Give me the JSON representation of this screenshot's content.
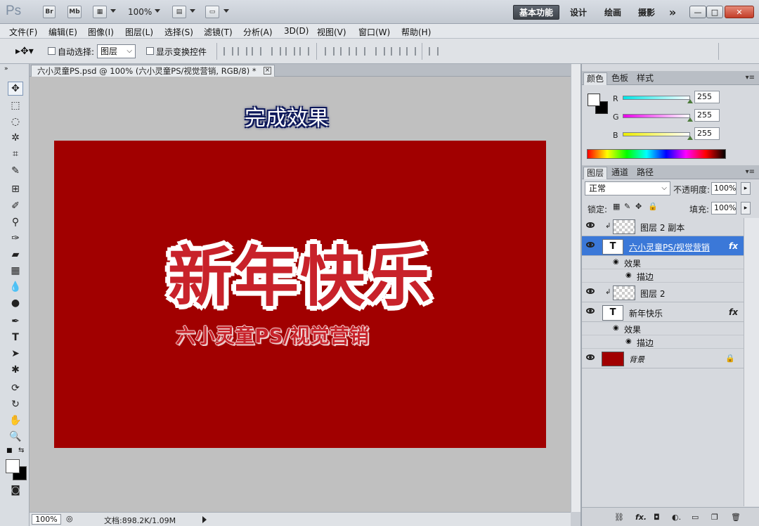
{
  "titlebar": {
    "app_logo": "Ps",
    "btn_br": "Br",
    "btn_mb": "Mb",
    "zoom": "100%",
    "workspaces": [
      "基本功能",
      "设计",
      "绘画",
      "摄影"
    ],
    "more": "»"
  },
  "menu": [
    "文件(F)",
    "编辑(E)",
    "图像(I)",
    "图层(L)",
    "选择(S)",
    "滤镜(T)",
    "分析(A)",
    "3D(D)",
    "视图(V)",
    "窗口(W)",
    "帮助(H)"
  ],
  "options": {
    "auto_select_label": "自动选择:",
    "auto_select_value": "图层",
    "show_transform_label": "显示变换控件"
  },
  "document": {
    "tab_title": "六小灵童PS.psd @ 100% (六小灵童PS/视觉营销, RGB/8) *",
    "close": "×"
  },
  "canvas": {
    "headline": "完成效果",
    "big_title": "新年快乐",
    "sub_title": "六小灵童PS/视觉营销",
    "background_color": "#a10000"
  },
  "status": {
    "zoom": "100%",
    "doc_info": "文档:898.2K/1.09M"
  },
  "color_panel": {
    "tabs": [
      "颜色",
      "色板",
      "样式"
    ],
    "channels": [
      {
        "label": "R",
        "value": "255",
        "color": "#00e5e5"
      },
      {
        "label": "G",
        "value": "255",
        "color": "#e800e8"
      },
      {
        "label": "B",
        "value": "255",
        "color": "#eded00"
      }
    ]
  },
  "layers_panel": {
    "tabs": [
      "图层",
      "通道",
      "路径"
    ],
    "blend_mode": "正常",
    "opacity_label": "不透明度:",
    "opacity": "100%",
    "lock_label": "锁定:",
    "fill_label": "填充:",
    "fill": "100%",
    "layers": [
      {
        "name": "图层 2 副本"
      },
      {
        "name": "六小灵童PS/视觉营销",
        "fx": "fx"
      },
      {
        "name": "图层 2"
      },
      {
        "name": "新年快乐",
        "fx": "fx"
      },
      {
        "name": "背景"
      }
    ],
    "effects_label": "效果",
    "stroke_label": "描边"
  }
}
